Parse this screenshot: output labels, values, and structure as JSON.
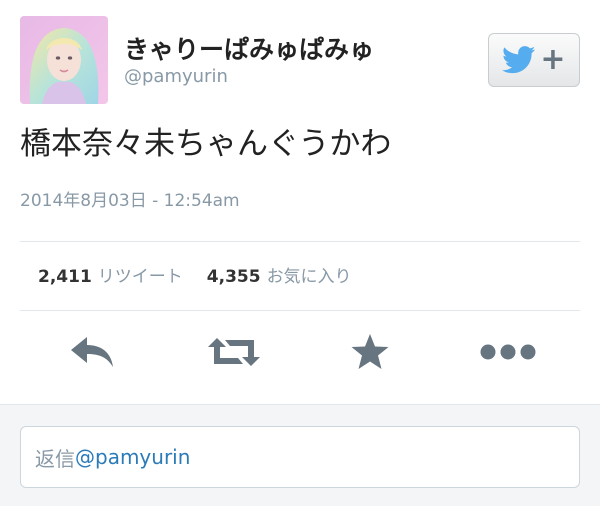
{
  "user": {
    "display_name": "きゃりーぱみゅぱみゅ",
    "handle": "@pamyurin"
  },
  "follow_button": {
    "icon": "twitter-bird-icon",
    "plus": "+"
  },
  "tweet": {
    "text": "橋本奈々未ちゃんぐうかわ",
    "timestamp": "2014年8月03日 - 12:54am"
  },
  "stats": {
    "retweets_count": "2,411",
    "retweets_label": "リツイート",
    "favorites_count": "4,355",
    "favorites_label": "お気に入り"
  },
  "actions": {
    "reply": "reply-icon",
    "retweet": "retweet-icon",
    "favorite": "star-icon",
    "more": "more-icon"
  },
  "reply_box": {
    "prefix": "返信",
    "mention": "@pamyurin"
  },
  "colors": {
    "twitter_blue": "#55acee",
    "gray_text": "#8899a6",
    "icon_gray": "#66757f"
  }
}
